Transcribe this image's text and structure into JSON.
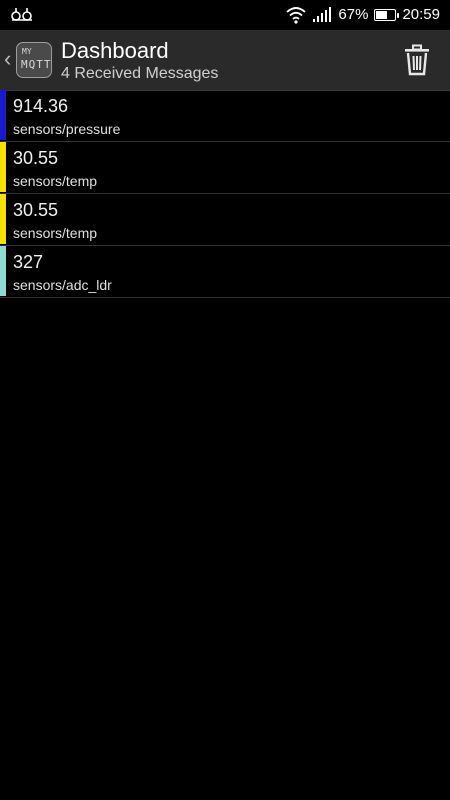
{
  "status_bar": {
    "left_icon": "app-notification-icon",
    "wifi_icon": "wifi-icon",
    "signal_icon": "cellular-signal-icon",
    "battery_percent": "67%",
    "battery_level": 0.67,
    "time": "20:59"
  },
  "app_bar": {
    "back_icon": "chevron-left-icon",
    "logo_line1": "MY",
    "logo_line2": "MQTT",
    "title": "Dashboard",
    "subtitle": "4 Received Messages",
    "delete_icon": "trash-icon"
  },
  "messages": [
    {
      "value": "914.36",
      "topic": "sensors/pressure",
      "color": "#1a1acc"
    },
    {
      "value": "30.55",
      "topic": "sensors/temp",
      "color": "#f5e100"
    },
    {
      "value": "30.55",
      "topic": "sensors/temp",
      "color": "#f5e100"
    },
    {
      "value": "327",
      "topic": "sensors/adc_ldr",
      "color": "#8fd9d2"
    }
  ]
}
